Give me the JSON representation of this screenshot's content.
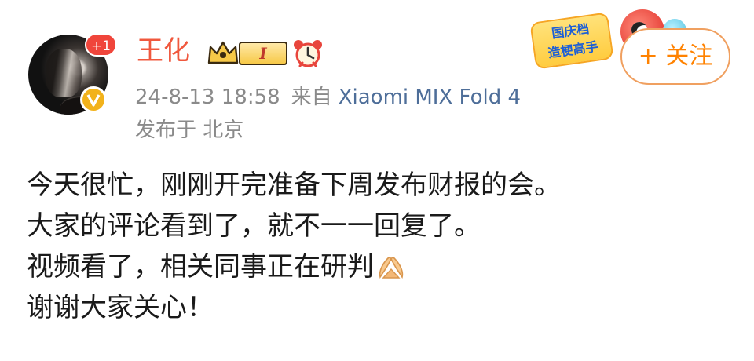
{
  "post": {
    "author": {
      "name": "王化",
      "vip_level": "I",
      "avatar_badge": "+1",
      "verified": "V"
    },
    "timestamp": "24-8-13 18:58",
    "source_prefix": "来自",
    "device": "Xiaomi MIX Fold 4",
    "location": "发布于 北京",
    "follow_label": "+ 关注",
    "promo": {
      "line1": "国庆档",
      "line2": "造梗高手"
    },
    "content_lines": [
      "今天很忙，刚刚开完准备下周发布财报的会。",
      "大家的评论看到了，就不一一回复了。",
      "视频看了，相关同事正在研判",
      "谢谢大家关心！"
    ],
    "icons": [
      "vip-crown-icon",
      "clock-icon",
      "clap-hands-icon",
      "verified-icon"
    ]
  },
  "colors": {
    "username": "#f0583e",
    "device_link": "#4e6e99",
    "meta_text": "#8a8a8a",
    "follow": "#ff8200",
    "badge": "#f0453b"
  }
}
